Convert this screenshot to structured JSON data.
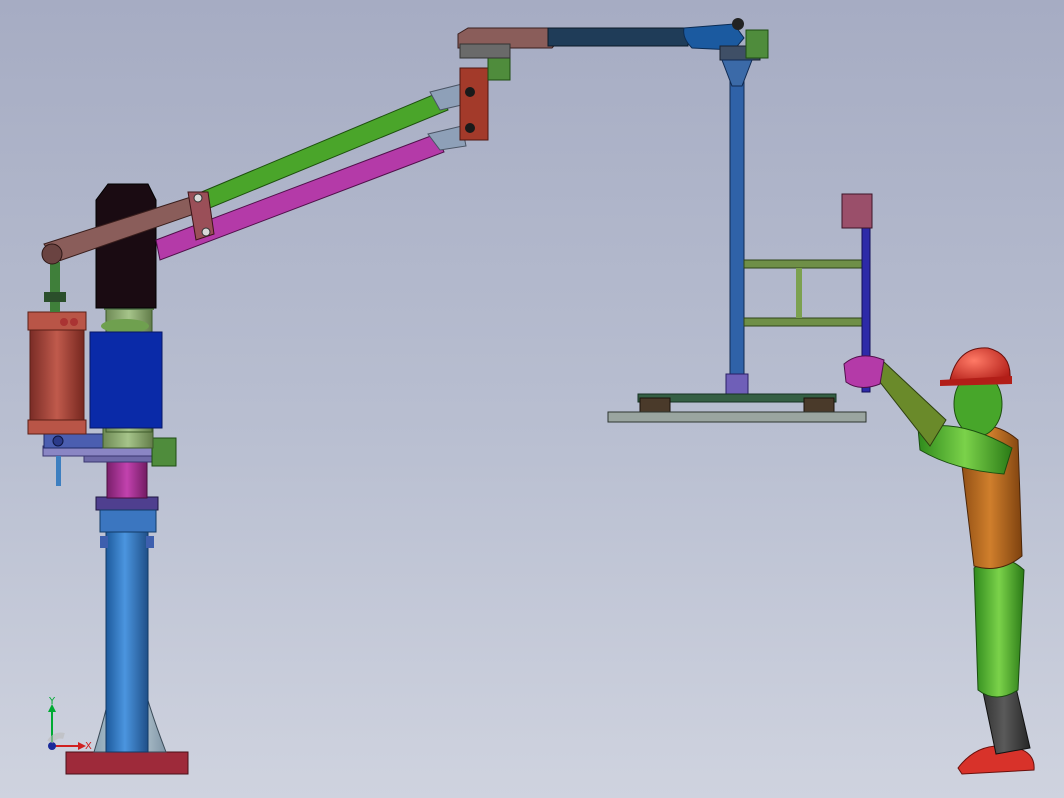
{
  "window": {
    "title": ""
  },
  "axis_triad": {
    "x_label": "X",
    "y_label": "Y"
  },
  "colors": {
    "background_top": "#a6acc3",
    "background_bottom": "#cfd3df",
    "column_blue": "#2f78c4",
    "base_plate": "#9e2a3a",
    "motor_block": "#1a0b12",
    "counterweight_block": "#0a2aa8",
    "cylinder": "#a8463d",
    "arm_upper": "#4aa52a",
    "arm_lower": "#b43aa8",
    "boom": "#1f3c58",
    "worker_helmet": "#d8322a",
    "worker_body": "#5aa82e",
    "worker_torso": "#b8651c"
  },
  "icons": {
    "axis_triad": "xyz-triad-icon"
  }
}
